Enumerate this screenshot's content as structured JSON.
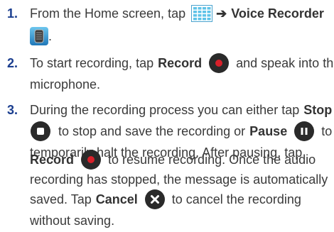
{
  "step1": {
    "number": "1.",
    "text_a": "From the Home screen, tap",
    "arrow": "➔",
    "app_name": "Voice Recorder",
    "end": "."
  },
  "step2": {
    "number": "2.",
    "text_a": "To start recording, tap",
    "record": "Record",
    "text_b": "and speak into the",
    "text_c": "microphone."
  },
  "step3": {
    "number": "3.",
    "l1_a": "During the recording process you can either tap",
    "l1_stop": "Stop",
    "l2_a": "to stop and save the recording or",
    "l2_pause": "Pause",
    "l2_b": "to",
    "l3": "temporarily halt the recording. After pausing, tap",
    "l4_record": "Record",
    "l4_b": "to resume recording. Once the audio",
    "l5": "recording has stopped, the message is automatically",
    "l6_a": "saved. Tap",
    "l6_cancel": "Cancel",
    "l6_b": "to cancel the recording",
    "l7": "without saving."
  },
  "colors": {
    "step_number": "#1b3e8f",
    "body_text": "#3a3a3a",
    "button_dark": "#2a2a2a",
    "record_dot": "#d8202a",
    "apps_grid": "#5fc3e8"
  },
  "icons": [
    "apps-grid-icon",
    "voice-recorder-app-icon",
    "record-button-icon",
    "stop-button-icon",
    "pause-button-icon",
    "cancel-button-icon"
  ]
}
